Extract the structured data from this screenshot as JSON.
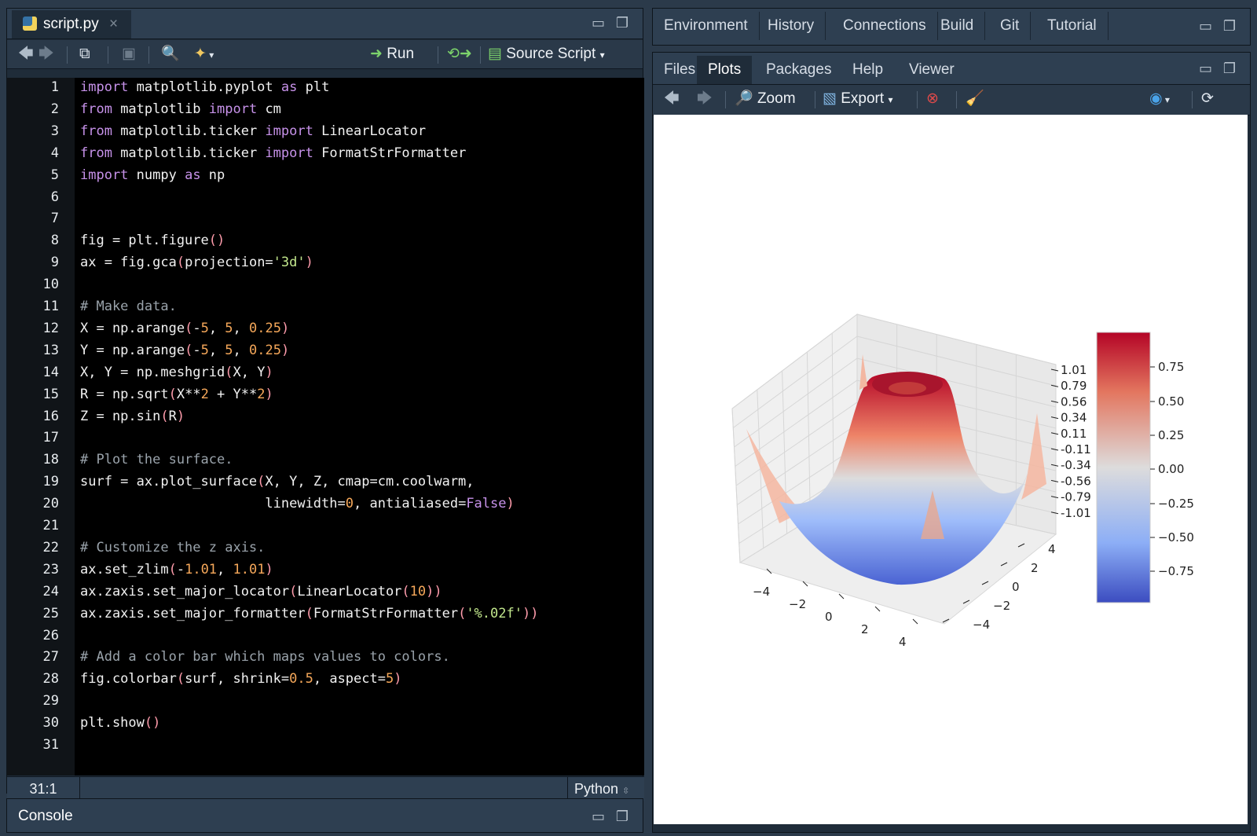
{
  "editor": {
    "file_tab": "script.py",
    "toolbar": {
      "run_label": "Run",
      "source_label": "Source Script"
    },
    "lines": [
      "<span class=\"kw\">import</span> matplotlib.pyplot <span class=\"kw\">as</span> plt",
      "<span class=\"kw\">from</span> matplotlib <span class=\"kw\">import</span> cm",
      "<span class=\"kw\">from</span> matplotlib.ticker <span class=\"kw\">import</span> LinearLocator",
      "<span class=\"kw\">from</span> matplotlib.ticker <span class=\"kw\">import</span> FormatStrFormatter",
      "<span class=\"kw\">import</span> numpy <span class=\"kw\">as</span> np",
      "",
      "",
      "fig = plt.figure<span class=\"par\">()</span>",
      "ax = fig.gca<span class=\"par\">(</span>projection=<span class=\"str\">'3d'</span><span class=\"par\">)</span>",
      "",
      "<span class=\"cm\"># Make data.</span>",
      "X = np.arange<span class=\"par\">(</span>-<span class=\"num\">5</span>, <span class=\"num\">5</span>, <span class=\"num\">0.25</span><span class=\"par\">)</span>",
      "Y = np.arange<span class=\"par\">(</span>-<span class=\"num\">5</span>, <span class=\"num\">5</span>, <span class=\"num\">0.25</span><span class=\"par\">)</span>",
      "X, Y = np.meshgrid<span class=\"par\">(</span>X, Y<span class=\"par\">)</span>",
      "R = np.sqrt<span class=\"par\">(</span>X**<span class=\"num\">2</span> + Y**<span class=\"num\">2</span><span class=\"par\">)</span>",
      "Z = np.sin<span class=\"par\">(</span>R<span class=\"par\">)</span>",
      "",
      "<span class=\"cm\"># Plot the surface.</span>",
      "surf = ax.plot_surface<span class=\"par\">(</span>X, Y, Z, cmap=cm.coolwarm,",
      "                       linewidth=<span class=\"num\">0</span>, antialiased=<span class=\"bool\">False</span><span class=\"par\">)</span>",
      "",
      "<span class=\"cm\"># Customize the z axis.</span>",
      "ax.set_zlim<span class=\"par\">(</span>-<span class=\"num\">1.01</span>, <span class=\"num\">1.01</span><span class=\"par\">)</span>",
      "ax.zaxis.set_major_locator<span class=\"par\">(</span>LinearLocator<span class=\"par\">(</span><span class=\"num\">10</span><span class=\"par\">))</span>",
      "ax.zaxis.set_major_formatter<span class=\"par\">(</span>FormatStrFormatter<span class=\"par\">(</span><span class=\"str\">'%.02f'</span><span class=\"par\">))</span>",
      "",
      "<span class=\"cm\"># Add a color bar which maps values to colors.</span>",
      "fig.colorbar<span class=\"par\">(</span>surf, shrink=<span class=\"num\">0.5</span>, aspect=<span class=\"num\">5</span><span class=\"par\">)</span>",
      "",
      "plt.show<span class=\"par\">()</span>",
      ""
    ],
    "status_position": "31:1",
    "status_language": "Python"
  },
  "console": {
    "title": "Console"
  },
  "top_right": {
    "tabs": [
      "Environment",
      "History",
      "Connections",
      "Build",
      "Git",
      "Tutorial"
    ]
  },
  "files_pane": {
    "tabs": [
      "Files",
      "Plots",
      "Packages",
      "Help",
      "Viewer"
    ],
    "active_tab": "Plots",
    "toolbar": {
      "zoom_label": "Zoom",
      "export_label": "Export"
    }
  },
  "plot": {
    "x_ticks": [
      "−4",
      "−2",
      "0",
      "2",
      "4"
    ],
    "y_ticks": [
      "4",
      "2",
      "0",
      "−2",
      "−4"
    ],
    "z_ticks": [
      "1.01",
      "0.79",
      "0.56",
      "0.34",
      "0.11",
      "-0.11",
      "-0.34",
      "-0.56",
      "-0.79",
      "-1.01"
    ],
    "colorbar_ticks": [
      "0.75",
      "0.50",
      "0.25",
      "0.00",
      "−0.25",
      "−0.50",
      "−0.75"
    ],
    "colors": {
      "high": "#b40426",
      "mid": "#dddcdc",
      "low": "#3b4cc0"
    }
  }
}
